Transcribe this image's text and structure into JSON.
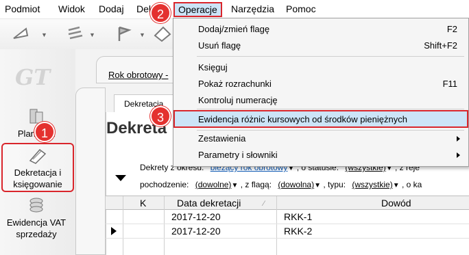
{
  "menubar": {
    "items": [
      "Podmiot",
      "Widok",
      "Dodaj",
      "Dekre",
      "Operacje",
      "Narzędzia",
      "Pomoc"
    ]
  },
  "toolbar": {
    "icons": [
      "arrow-tool-icon",
      "lines-tool-icon",
      "flag-tool-icon",
      "eraser-tool-icon"
    ]
  },
  "sidebar": {
    "logo": "GT",
    "items": [
      {
        "label": "Plan kont",
        "icon": "plan-kont-icon"
      },
      {
        "label": "Dekretacja i księgowanie",
        "icon": "dekretacja-icon"
      },
      {
        "label": "Ewidencja VAT sprzedaży",
        "icon": "ewidencja-vat-icon"
      }
    ]
  },
  "content": {
    "period_label": "Rok obrotowy -",
    "tab_label": "Dekretacja",
    "page_title": "Dekreta",
    "filters": {
      "line1": {
        "prefix": "Dekrety z okresu:",
        "period_value": "bieżący rok obrotowy",
        "status_label": ", o statusie:",
        "status_value": "(wszystkie)",
        "suffix": ", z reje"
      },
      "line2": {
        "origin_label": "pochodzenie:",
        "origin_value": "(dowolne)",
        "flag_label": ", z flagą:",
        "flag_value": "(dowolna)",
        "type_label": ", typu:",
        "type_value": "(wszystkie)",
        "suffix": ", o ka"
      }
    }
  },
  "grid": {
    "columns": [
      "K",
      "Data dekretacji",
      "Dowód"
    ],
    "rows": [
      {
        "date": "2017-12-20",
        "doc": "RKK-1",
        "current": false
      },
      {
        "date": "2017-12-20",
        "doc": "RKK-2",
        "current": true
      }
    ]
  },
  "dropdown": {
    "items": [
      {
        "label": "Dodaj/zmień flagę",
        "shortcut": "F2"
      },
      {
        "label": "Usuń flagę",
        "shortcut": "Shift+F2"
      },
      {
        "label": "Księguj",
        "shortcut": ""
      },
      {
        "label": "Pokaż rozrachunki",
        "shortcut": "F11"
      },
      {
        "label": "Kontroluj numerację",
        "shortcut": ""
      },
      {
        "label": "Ewidencja różnic kursowych od środków pieniężnych",
        "shortcut": ""
      },
      {
        "label": "Zestawienia",
        "shortcut": ""
      },
      {
        "label": "Parametry i słowniki",
        "shortcut": ""
      }
    ]
  },
  "steps": [
    "1",
    "2",
    "3"
  ],
  "colors": {
    "highlight_border": "#d9252b",
    "highlight_fill": "#cce4f7",
    "step_marker": "#e4312f",
    "link": "#0b58b4"
  }
}
